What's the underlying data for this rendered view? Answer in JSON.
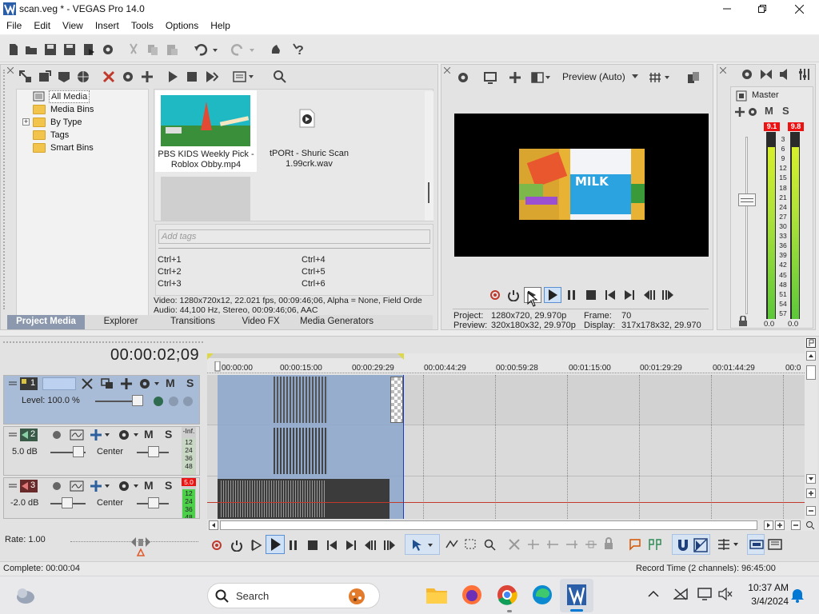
{
  "window": {
    "title": "scan.veg * - VEGAS Pro 14.0",
    "minimize_icon": "minimize-icon",
    "maximize_icon": "restore-icon",
    "close_icon": "close-icon"
  },
  "menu": [
    "File",
    "Edit",
    "View",
    "Insert",
    "Tools",
    "Options",
    "Help"
  ],
  "project_media": {
    "tree": [
      {
        "label": "All Media",
        "selected": true,
        "expander": ""
      },
      {
        "label": "Media Bins",
        "selected": false,
        "expander": ""
      },
      {
        "label": "By Type",
        "selected": false,
        "expander": "+"
      },
      {
        "label": "Tags",
        "selected": false,
        "expander": ""
      },
      {
        "label": "Smart Bins",
        "selected": false,
        "expander": ""
      }
    ],
    "items": [
      {
        "name": "PBS KIDS Weekly Pick - Roblox Obby.mp4",
        "line1": "PBS KIDS Weekly Pick -",
        "line2": "Roblox Obby.mp4",
        "kind": "video"
      },
      {
        "name": "tPORt - Shuric Scan 1.99crk.wav",
        "line1": "tPORt - Shuric Scan",
        "line2": "1.99crk.wav",
        "kind": "audio"
      }
    ],
    "tags_placeholder": "Add tags",
    "shortcuts": [
      "Ctrl+1",
      "Ctrl+4",
      "Ctrl+2",
      "Ctrl+5",
      "Ctrl+3",
      "Ctrl+6"
    ],
    "info_line1": "Video: 1280x720x12, 22.021 fps, 00:09:46;06, Alpha = None, Field Orde",
    "info_line2": "Audio: 44,100 Hz, Stereo, 00:09:46;06, AAC"
  },
  "tabs": [
    "Project Media",
    "Explorer",
    "Transitions",
    "Video FX",
    "Media Generators"
  ],
  "preview": {
    "mode": "Preview (Auto)",
    "overlay_text": "MILK",
    "project_label": "Project:",
    "project_value": "1280x720, 29.970p",
    "preview_label": "Preview:",
    "preview_value": "320x180x32, 29.970p",
    "frame_label": "Frame:",
    "frame_value": "70",
    "display_label": "Display:",
    "display_value": "317x178x32, 29.970"
  },
  "master": {
    "title": "Master",
    "m_label": "M",
    "s_label": "S",
    "peak_left": "9.1",
    "peak_right": "9.8",
    "scale": [
      "3",
      "6",
      "9",
      "12",
      "15",
      "18",
      "21",
      "24",
      "27",
      "30",
      "33",
      "36",
      "39",
      "42",
      "45",
      "48",
      "51",
      "54",
      "57"
    ],
    "level_left": "0.0",
    "level_right": "0.0",
    "meter_fill_left": 0.92,
    "meter_fill_right": 0.92
  },
  "timeline": {
    "current_time": "00:00:02;09",
    "ruler": [
      "00:00:00",
      "00:00:15:00",
      "00:00:29:29",
      "00:00:44:29",
      "00:00:59:28",
      "00:01:15:00",
      "00:01:29:29",
      "00:01:44:29",
      "00:0"
    ],
    "tracks": [
      {
        "number": "1",
        "type": "video",
        "level": "Level: 100.0 %",
        "m": "M",
        "s": "S"
      },
      {
        "number": "2",
        "type": "audio",
        "volume": "5.0 dB",
        "pan": "Center",
        "m": "M",
        "s": "S",
        "meter_top": "-Inf.",
        "meter_scale": [
          "12",
          "24",
          "36",
          "48"
        ]
      },
      {
        "number": "3",
        "type": "audio",
        "volume": "-2.0 dB",
        "pan": "Center",
        "m": "M",
        "s": "S",
        "meter_top": "5.0",
        "meter_scale": [
          "12",
          "24",
          "36",
          "48"
        ]
      }
    ],
    "rate": "Rate: 1.00"
  },
  "status": {
    "complete": "Complete: 00:00:04",
    "record_time": "Record Time (2 channels): 96:45:00"
  },
  "taskbar": {
    "search_placeholder": "Search",
    "time": "10:37 AM",
    "date": "3/4/2024"
  },
  "colors": {
    "accent_blue": "#0078d4",
    "track_blue": "#8fa9cc",
    "tab_active": "#8b98ad",
    "meter_red": "#e11111"
  }
}
